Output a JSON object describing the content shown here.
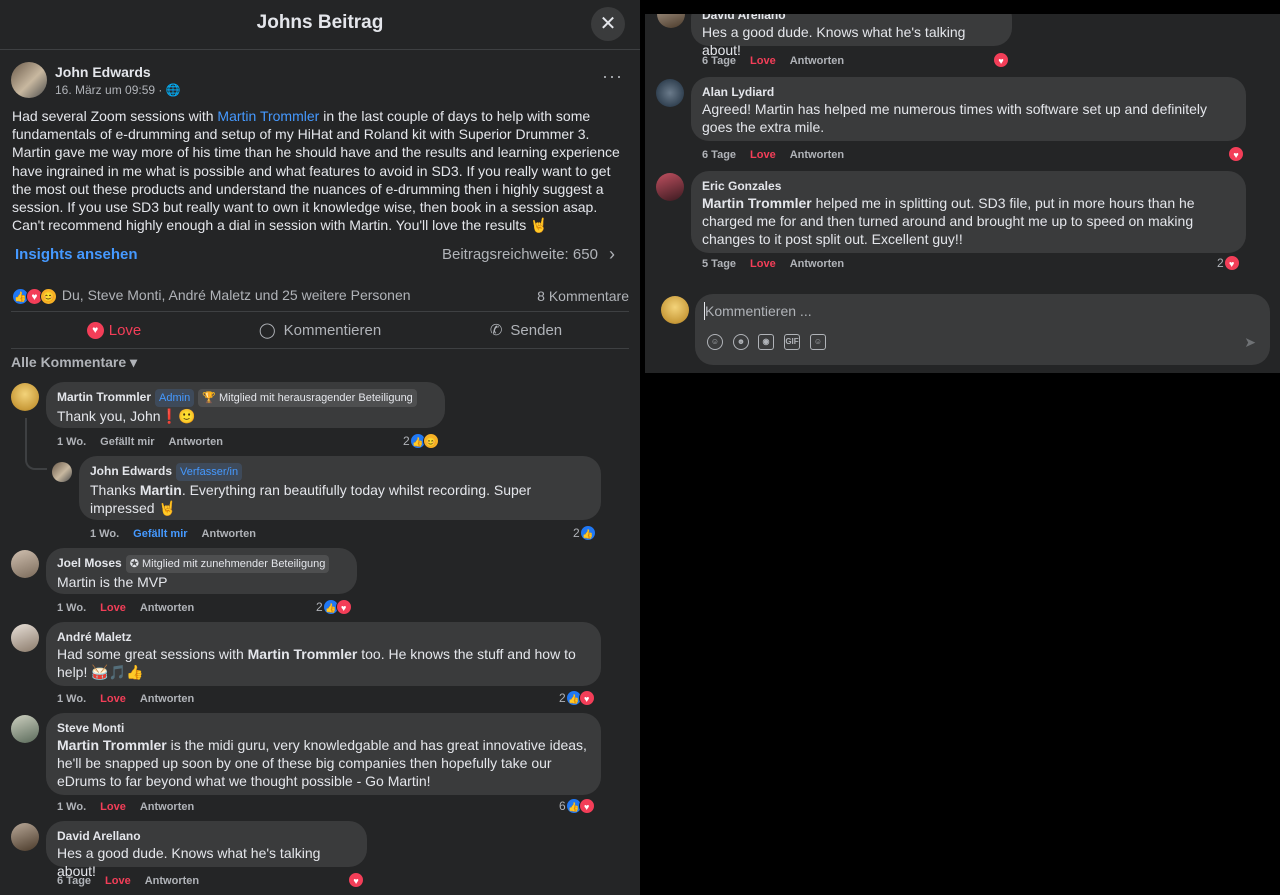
{
  "dialog": {
    "title": "Johns Beitrag",
    "close_icon": "close-icon"
  },
  "post": {
    "author": "John Edwards",
    "meta": "16. März um 09:59 · ",
    "text_before": "Had several Zoom sessions with ",
    "mention": "Martin Trommler",
    "text_after": " in the last couple of days to help with some fundamentals of e-drumming and setup of my HiHat and Roland kit with Superior Drummer 3. Martin gave me way more of his time than he should have and the results and learning experience have ingrained in me what is possible and what features to avoid in SD3. If you really want to get the most out these products and understand the nuances of e-drumming then i highly suggest a session. If you use SD3 but really want to own it knowledge wise,  then book in a session asap. Can't recommend highly enough a dial in session with Martin. You'll love the results 🤘",
    "insights_label": "Insights ansehen",
    "reach_label": "Beitragsreichweite: 650",
    "reactions_text": "Du, Steve Monti, André Maletz und 25 weitere Personen",
    "comments_count": "8 Kommentare",
    "actions": {
      "love": "Love",
      "comment": "Kommentieren",
      "share": "Senden"
    },
    "filter_label": "Alle Kommentare"
  },
  "comments": [
    {
      "name": "Martin Trommler",
      "badge1": "Admin",
      "badge2": "🏆 Mitglied mit herausragender Beteiligung",
      "text": "Thank you, John❗🙂",
      "time": "1 Wo.",
      "like": "Gefällt mir",
      "reply": "Antworten",
      "count": "2"
    },
    {
      "name": "John Edwards",
      "badge1": "Verfasser/in",
      "text_pre": "Thanks ",
      "text_bold": "Martin",
      "text_post": ". Everything ran beautifully today whilst recording. Super impressed 🤘",
      "time": "1 Wo.",
      "like": "Gefällt mir",
      "reply": "Antworten",
      "count": "2"
    },
    {
      "name": "Joel Moses",
      "badge2": "✪ Mitglied mit zunehmender Beteiligung",
      "text": "Martin is the MVP",
      "time": "1 Wo.",
      "like": "Love",
      "reply": "Antworten",
      "count": "2"
    },
    {
      "name": "André Maletz",
      "text_pre": "Had some great sessions with ",
      "text_bold": "Martin Trommler",
      "text_post": " too. He knows the stuff and how to help! 🥁🎵👍",
      "time": "1 Wo.",
      "like": "Love",
      "reply": "Antworten",
      "count": "2"
    },
    {
      "name": "Steve Monti",
      "text_bold": "Martin Trommler",
      "text_post": " is the midi guru, very knowledgable and has great innovative ideas, he'll be snapped up soon by one of these big companies then hopefully take our eDrums to far beyond what we thought possible - Go Martin!",
      "time": "1 Wo.",
      "like": "Love",
      "reply": "Antworten",
      "count": "6"
    },
    {
      "name": "David Arellano",
      "text": "Hes a good dude. Knows what he's talking about!",
      "time": "6 Tage",
      "like": "Love",
      "reply": "Antworten"
    }
  ],
  "right_comments": [
    {
      "name": "David Arellano",
      "text": "Hes a good dude. Knows what he's talking about!",
      "time": "6 Tage",
      "like": "Love",
      "reply": "Antworten"
    },
    {
      "name": "Alan Lydiard",
      "text": "Agreed! Martin has helped me numerous times with software set up and definitely goes the extra mile.",
      "time": "6 Tage",
      "like": "Love",
      "reply": "Antworten"
    },
    {
      "name": "Eric Gonzales",
      "text_bold": "Martin Trommler",
      "text_post": " helped me in splitting out. SD3 file, put in more hours than he charged me for and then turned around and brought me up to speed on making changes to it post split out. Excellent guy!!",
      "time": "5 Tage",
      "like": "Love",
      "reply": "Antworten",
      "count": "2"
    }
  ],
  "composer": {
    "placeholder": "Kommentieren ...",
    "tools": [
      "emoji-icon",
      "smiley-icon",
      "camera-icon",
      "gif-icon",
      "sticker-icon"
    ]
  }
}
